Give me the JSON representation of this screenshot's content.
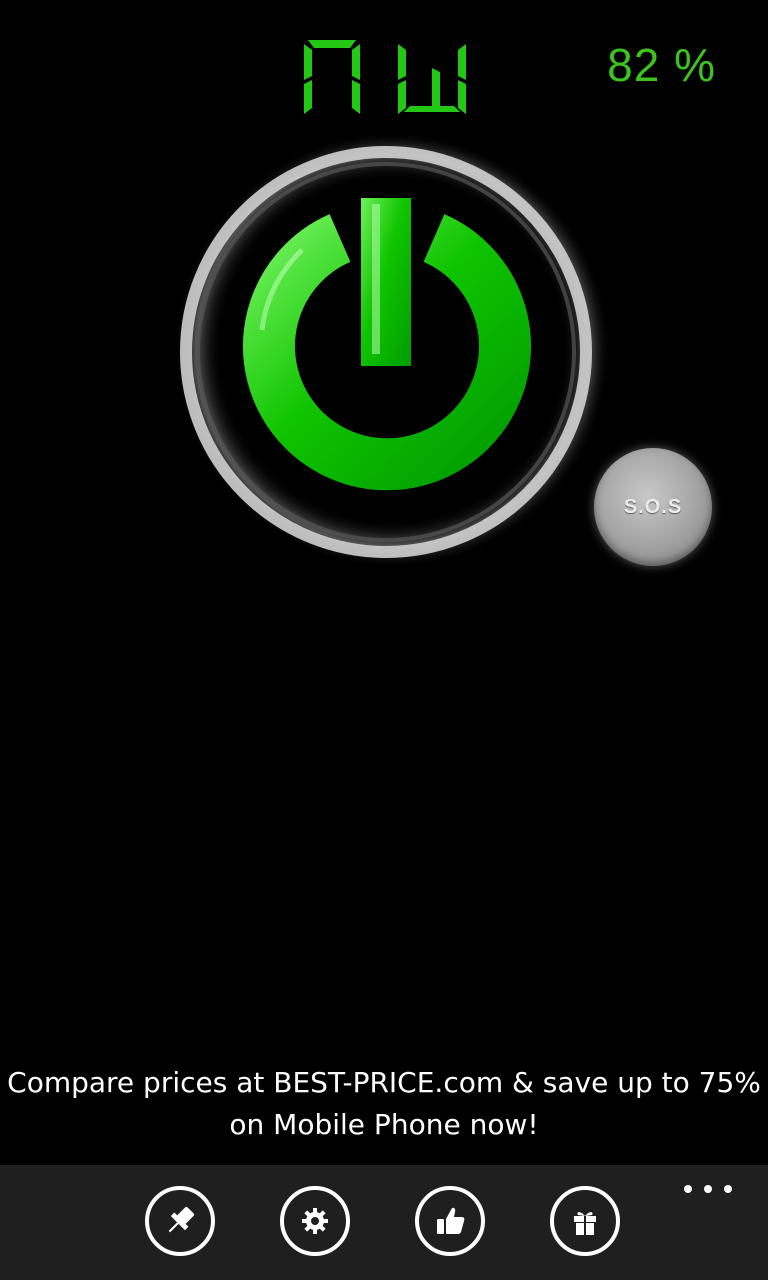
{
  "mode_display": {
    "text": "ON"
  },
  "battery": {
    "level_text": "82 %"
  },
  "colors": {
    "accent": "#00c000",
    "battery": "#3ec21f",
    "app_bar": "#1f1f1f"
  },
  "power_button": {
    "icon": "power-icon"
  },
  "sos_button": {
    "label": "S.O.S"
  },
  "ad_banner": {
    "line1": "Compare prices at BEST-PRICE.com & save up to 75%",
    "line2": "on Mobile Phone now!"
  },
  "app_bar": {
    "buttons": [
      {
        "icon": "pin-icon"
      },
      {
        "icon": "gear-icon"
      },
      {
        "icon": "thumbs-up-icon"
      },
      {
        "icon": "gift-icon"
      }
    ],
    "more_icon": "more-icon"
  }
}
